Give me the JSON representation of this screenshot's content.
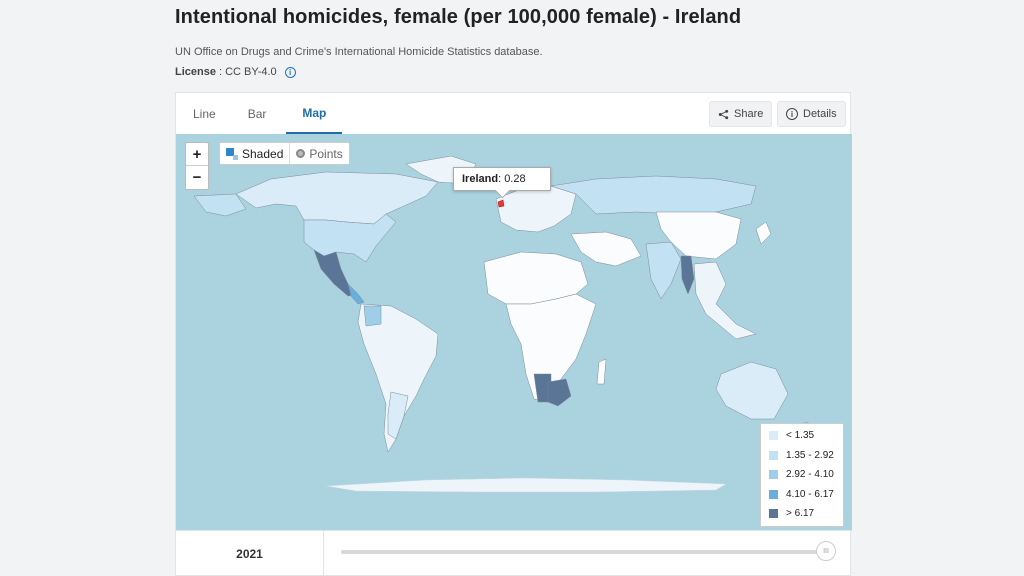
{
  "header": {
    "title": "Intentional homicides, female (per 100,000 female) - Ireland",
    "source": "UN Office on Drugs and Crime's International Homicide Statistics database.",
    "license_label": "License",
    "license_value": ": CC BY-4.0"
  },
  "tabs": [
    {
      "label": "Line",
      "active": false
    },
    {
      "label": "Bar",
      "active": false
    },
    {
      "label": "Map",
      "active": true
    }
  ],
  "actions": {
    "share_label": "Share",
    "details_label": "Details"
  },
  "map": {
    "zoom_in": "+",
    "zoom_out": "−",
    "mode_shaded": "Shaded",
    "mode_points": "Points",
    "tooltip_country": "Ireland",
    "tooltip_value": " : 0.28",
    "ocean_color": "#aad3df",
    "highlight_color": "#e03a3a"
  },
  "legend": [
    {
      "label": "< 1.35",
      "color": "#d9ecf7"
    },
    {
      "label": "1.35 - 2.92",
      "color": "#c2e1f2"
    },
    {
      "label": "2.92 - 4.10",
      "color": "#9fcfe8"
    },
    {
      "label": "4.10 - 6.17",
      "color": "#6aaee0"
    },
    {
      "label": "> 6.17",
      "color": "#5a7596"
    }
  ],
  "timeline": {
    "year": "2021",
    "handle": "III"
  }
}
